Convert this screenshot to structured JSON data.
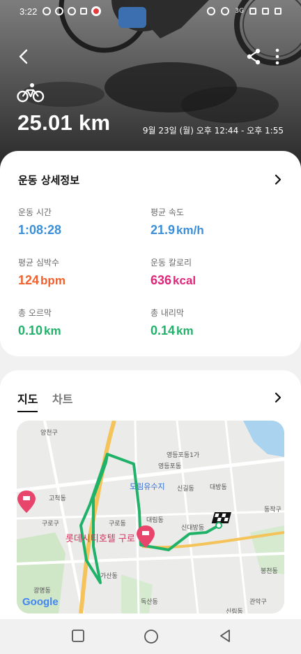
{
  "status_bar": {
    "time": "3:22",
    "network": "3G",
    "icons": [
      "download-icon",
      "cloud-icon",
      "ring-icon",
      "square-icon",
      "recording-icon",
      "location-icon",
      "alarm-icon",
      "wifi-icon",
      "signal-icon",
      "battery-icon"
    ]
  },
  "header": {
    "activity_icon": "bicycle-icon",
    "distance": "25.01 km",
    "datetime": "9월 23일 (월) 오후 12:44 - 오후 1:55",
    "back_icon": "back-arrow-icon",
    "share_icon": "share-icon",
    "more_icon": "more-vert-icon"
  },
  "details": {
    "title": "운동 상세정보",
    "stats": [
      {
        "label": "운동 시간",
        "value": "1:08:28",
        "unit": "",
        "color": "#3b8fd9"
      },
      {
        "label": "평균 속도",
        "value": "21.9",
        "unit": "km/h",
        "color": "#3b8fd9"
      },
      {
        "label": "평균 심박수",
        "value": "124",
        "unit": "bpm",
        "color": "#f0612d"
      },
      {
        "label": "운동 칼로리",
        "value": "636",
        "unit": "kcal",
        "color": "#e1267a"
      },
      {
        "label": "총 오르막",
        "value": "0.10",
        "unit": "km",
        "color": "#21b26a"
      },
      {
        "label": "총 내리막",
        "value": "0.14",
        "unit": "km",
        "color": "#21b26a"
      }
    ]
  },
  "map_section": {
    "tabs": [
      "지도",
      "차트"
    ],
    "active_tab": "지도",
    "places": {
      "yangcheon": "양천구",
      "yeongdeungpo1": "영등포동1가",
      "yeongdeungpo": "영등포동",
      "singil": "신길동",
      "daebang": "대방동",
      "gocheok": "고척동",
      "dorim": "도림유수지",
      "guro_gu": "구로구",
      "guro_dong": "구로동",
      "daerim": "대림동",
      "dongjak": "동작구",
      "sindaebang": "신대방동",
      "hotel": "롯데시티호텔 구로",
      "gasan": "가산동",
      "bongcheon": "봉천동",
      "gwangmyeong": "광명동",
      "doksan": "독산동",
      "gwanak": "관악구",
      "sillim": "신림동"
    },
    "attribution": "Google",
    "route_color": "#21b26a"
  },
  "nav": {
    "buttons": [
      "recents-icon",
      "home-icon",
      "back-icon"
    ]
  }
}
